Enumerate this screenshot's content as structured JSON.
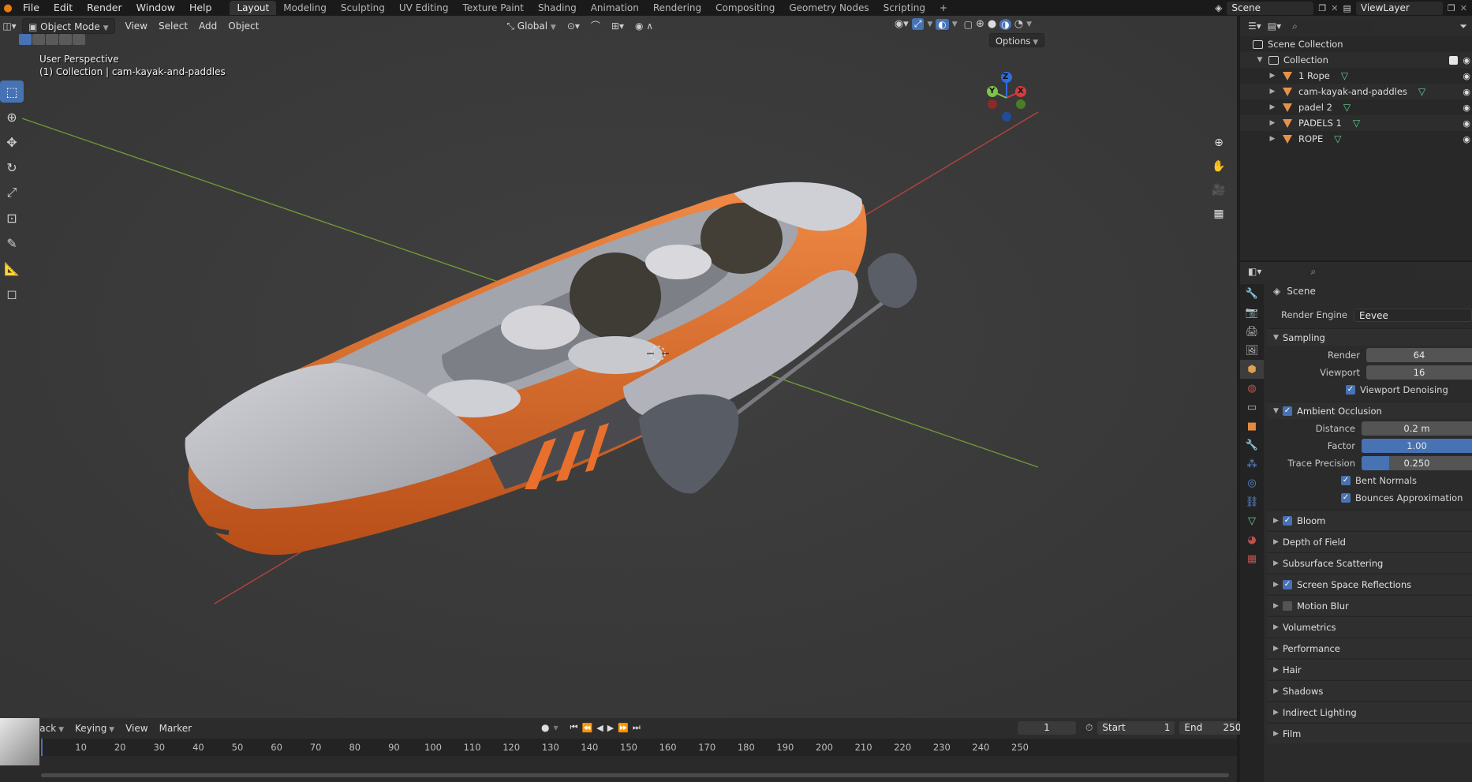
{
  "topbar": {
    "menus": [
      "File",
      "Edit",
      "Render",
      "Window",
      "Help"
    ],
    "workspaces": [
      "Layout",
      "Modeling",
      "Sculpting",
      "UV Editing",
      "Texture Paint",
      "Shading",
      "Animation",
      "Rendering",
      "Compositing",
      "Geometry Nodes",
      "Scripting"
    ],
    "active_workspace": "Layout",
    "add_tab": "+",
    "scene": "Scene",
    "view_layer": "ViewLayer"
  },
  "viewport": {
    "mode": "Object Mode",
    "menus": [
      "View",
      "Select",
      "Add",
      "Object"
    ],
    "orientation": "Global",
    "options": "Options",
    "perspective": "User Perspective",
    "active_info": "(1) Collection | cam-kayak-and-paddles",
    "gizmo": {
      "x": "X",
      "y": "Y",
      "z": "Z"
    }
  },
  "timeline": {
    "menus": [
      "Playback",
      "Keying",
      "View",
      "Marker"
    ],
    "current_frame": "1",
    "start_label": "Start",
    "start": "1",
    "end_label": "End",
    "end": "250",
    "ruler": [
      "10",
      "20",
      "30",
      "40",
      "50",
      "60",
      "70",
      "80",
      "90",
      "100",
      "110",
      "120",
      "130",
      "140",
      "150",
      "160",
      "170",
      "180",
      "190",
      "200",
      "210",
      "220",
      "230",
      "240",
      "250"
    ]
  },
  "outliner": {
    "root": "Scene Collection",
    "collection": "Collection",
    "objects": [
      "1 Rope",
      "cam-kayak-and-paddles",
      "padel 2",
      "PADELS 1",
      "ROPE"
    ]
  },
  "properties": {
    "context": "Scene",
    "render_engine_label": "Render Engine",
    "render_engine": "Eevee",
    "sampling": {
      "title": "Sampling",
      "render_label": "Render",
      "render": "64",
      "viewport_label": "Viewport",
      "viewport": "16",
      "denoise": "Viewport Denoising"
    },
    "ao": {
      "title": "Ambient Occlusion",
      "distance_label": "Distance",
      "distance": "0.2 m",
      "factor_label": "Factor",
      "factor": "1.00",
      "factor_fraction": 1.0,
      "trace_label": "Trace Precision",
      "trace": "0.250",
      "trace_fraction": 0.25,
      "bent_normals": "Bent Normals",
      "bounces": "Bounces Approximation"
    },
    "panels": [
      {
        "label": "Bloom",
        "checkbox": true,
        "checked": true
      },
      {
        "label": "Depth of Field",
        "checkbox": false
      },
      {
        "label": "Subsurface Scattering",
        "checkbox": false
      },
      {
        "label": "Screen Space Reflections",
        "checkbox": true,
        "checked": true
      },
      {
        "label": "Motion Blur",
        "checkbox": true,
        "checked": false
      },
      {
        "label": "Volumetrics",
        "checkbox": false
      },
      {
        "label": "Performance",
        "checkbox": false
      },
      {
        "label": "Hair",
        "checkbox": false
      },
      {
        "label": "Shadows",
        "checkbox": false
      },
      {
        "label": "Indirect Lighting",
        "checkbox": false
      },
      {
        "label": "Film",
        "checkbox": false
      }
    ]
  },
  "colors": {
    "accent": "#4772b3",
    "kayak_orange": "#e8702c",
    "kayak_grey": "#bfc0c6",
    "x_axis": "#c4433f",
    "y_axis": "#7ab135"
  }
}
